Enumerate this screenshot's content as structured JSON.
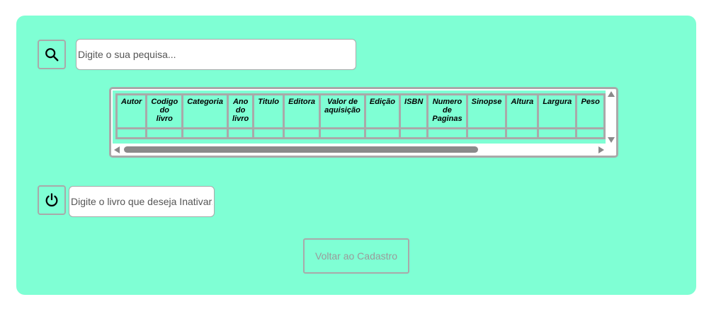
{
  "search": {
    "icon": "search-icon",
    "placeholder": "Digite o sua pequisa..."
  },
  "table": {
    "columns": [
      "Autor",
      "Codigo do livro",
      "Categoria",
      "Ano do livro",
      "Titulo",
      "Editora",
      "Valor de aquisição",
      "Edição",
      "ISBN",
      "Numero de Paginas",
      "Sinopse",
      "Altura",
      "Largura",
      "Peso"
    ]
  },
  "inactivate": {
    "icon": "power-icon",
    "placeholder": "Digite o livro que deseja Inativar.."
  },
  "actions": {
    "back_label": "Voltar ao Cadastro"
  },
  "colors": {
    "panel_background": "#7fffd4",
    "border": "#a9a9a9",
    "scrollbar": "#8a8a8a"
  }
}
